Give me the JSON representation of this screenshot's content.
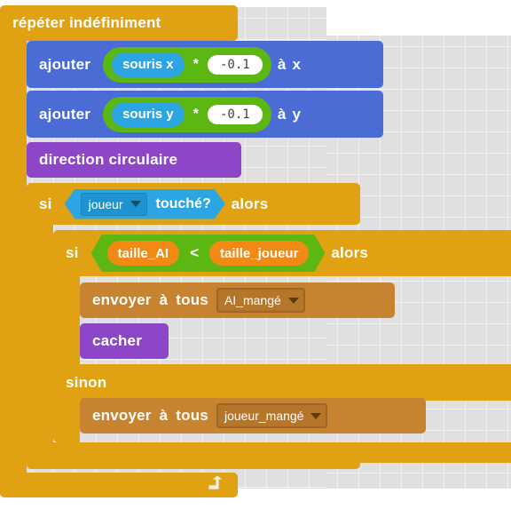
{
  "canvas": {
    "background_color": "#e0e0e0",
    "page_background": "#ffffff"
  },
  "palette": {
    "control": "#e0a213",
    "motion": "#4a6cd4",
    "operators": "#5cb712",
    "sensing": "#2ca5e2",
    "looks": "#8e46c8",
    "events": "#c88330",
    "variables": "#f08a14"
  },
  "script": {
    "forever": {
      "label": "répéter  indéfiniment",
      "loop_arrow_icon": "loop-arrow-icon"
    },
    "change_x": {
      "verb": "ajouter",
      "reporter": "souris x",
      "operator": "*",
      "number": "-0.1",
      "preposition": "à",
      "target": "x"
    },
    "change_y": {
      "verb": "ajouter",
      "reporter": "souris y",
      "operator": "*",
      "number": "-0.1",
      "preposition": "à",
      "target": "y"
    },
    "direction_block": {
      "label": "direction  circulaire"
    },
    "if_touching": {
      "if_label": "si",
      "then_label": "alors",
      "sensing": {
        "dropdown_value": "joueur",
        "dropdown_icon": "chevron-down-icon",
        "predicate": "touché?"
      }
    },
    "if_size_compare": {
      "if_label": "si",
      "then_label": "alors",
      "else_label": "sinon",
      "condition": {
        "left_operand": "taille_AI",
        "operator": "<",
        "right_operand": "taille_joueur"
      }
    },
    "broadcast_ai": {
      "verb": "envoyer",
      "preposition": "à",
      "scope": "tous",
      "message": "AI_mangé",
      "dropdown_icon": "chevron-down-icon"
    },
    "hide_block": {
      "label": "cacher"
    },
    "broadcast_player": {
      "verb": "envoyer",
      "preposition": "à",
      "scope": "tous",
      "message": "joueur_mangé",
      "dropdown_icon": "chevron-down-icon"
    }
  }
}
